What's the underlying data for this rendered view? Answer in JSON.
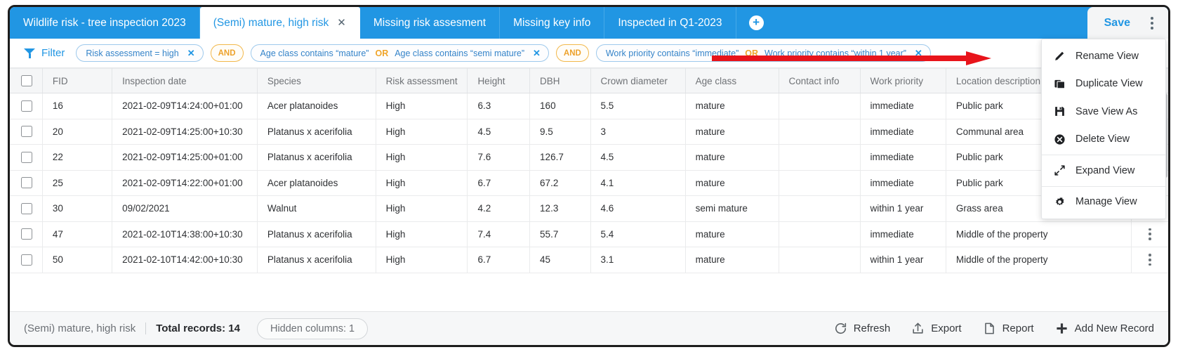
{
  "window": {
    "accent_blue": "#2196e3",
    "arrow_color": "#e8141b"
  },
  "tabs": [
    {
      "label": "Wildlife risk - tree inspection 2023",
      "active": false,
      "closable": false
    },
    {
      "label": "(Semi) mature, high risk",
      "active": true,
      "closable": true,
      "close_glyph": "✕"
    },
    {
      "label": "Missing risk assesment",
      "active": false,
      "closable": false
    },
    {
      "label": "Missing key info",
      "active": false,
      "closable": false
    },
    {
      "label": "Inspected in Q1-2023",
      "active": false,
      "closable": false
    }
  ],
  "tabbar": {
    "add_tab_glyph": "+",
    "add_tab_name": "add-view-tab",
    "save_label": "Save",
    "kebab_name": "view-options-kebab"
  },
  "filterbar": {
    "label": "Filter",
    "chips": [
      {
        "parts": [
          {
            "type": "text",
            "value": "Risk assessment = high"
          }
        ],
        "close_glyph": "✕"
      },
      {
        "parts": [
          {
            "type": "text",
            "value": "Age class contains “mature”"
          },
          {
            "type": "op",
            "value": "OR"
          },
          {
            "type": "text",
            "value": "Age class contains “semi mature”"
          }
        ],
        "close_glyph": "✕"
      },
      {
        "parts": [
          {
            "type": "text",
            "value": "Work priority contains “immediate”"
          },
          {
            "type": "op",
            "value": "OR"
          },
          {
            "type": "text",
            "value": "Work priority contains “within 1 year”"
          }
        ],
        "close_glyph": "✕"
      }
    ],
    "conjunctions": [
      "AND",
      "AND"
    ]
  },
  "table": {
    "columns": [
      "FID",
      "Inspection date",
      "Species",
      "Risk assessment",
      "Height",
      "DBH",
      "Crown diameter",
      "Age class",
      "Contact info",
      "Work priority",
      "Location description"
    ],
    "rows": [
      {
        "fid": "16",
        "inspection_date": "2021-02-09T14:24:00+01:00",
        "species": "Acer platanoides",
        "risk_assessment": "High",
        "height": "6.3",
        "dbh": "160",
        "crown_diameter": "5.5",
        "age_class": "mature",
        "contact_info": "",
        "work_priority": "immediate",
        "location_description": "Public park"
      },
      {
        "fid": "20",
        "inspection_date": "2021-02-09T14:25:00+10:30",
        "species": "Platanus x acerifolia",
        "risk_assessment": "High",
        "height": "4.5",
        "dbh": "9.5",
        "crown_diameter": "3",
        "age_class": "mature",
        "contact_info": "",
        "work_priority": "immediate",
        "location_description": "Communal area"
      },
      {
        "fid": "22",
        "inspection_date": "2021-02-09T14:25:00+01:00",
        "species": "Platanus x acerifolia",
        "risk_assessment": "High",
        "height": "7.6",
        "dbh": "126.7",
        "crown_diameter": "4.5",
        "age_class": "mature",
        "contact_info": "",
        "work_priority": "immediate",
        "location_description": "Public park"
      },
      {
        "fid": "25",
        "inspection_date": "2021-02-09T14:22:00+01:00",
        "species": "Acer platanoides",
        "risk_assessment": "High",
        "height": "6.7",
        "dbh": "67.2",
        "crown_diameter": "4.1",
        "age_class": "mature",
        "contact_info": "",
        "work_priority": "immediate",
        "location_description": "Public park"
      },
      {
        "fid": "30",
        "inspection_date": "09/02/2021",
        "species": "Walnut",
        "risk_assessment": "High",
        "height": "4.2",
        "dbh": "12.3",
        "crown_diameter": "4.6",
        "age_class": "semi mature",
        "contact_info": "",
        "work_priority": "within 1 year",
        "location_description": "Grass area"
      },
      {
        "fid": "47",
        "inspection_date": "2021-02-10T14:38:00+10:30",
        "species": "Platanus x acerifolia",
        "risk_assessment": "High",
        "height": "7.4",
        "dbh": "55.7",
        "crown_diameter": "5.4",
        "age_class": "mature",
        "contact_info": "",
        "work_priority": "immediate",
        "location_description": "Middle of the property"
      },
      {
        "fid": "50",
        "inspection_date": "2021-02-10T14:42:00+10:30",
        "species": "Platanus x acerifolia",
        "risk_assessment": "High",
        "height": "6.7",
        "dbh": "45",
        "crown_diameter": "3.1",
        "age_class": "mature",
        "contact_info": "",
        "work_priority": "within 1 year",
        "location_description": "Middle of the property"
      }
    ]
  },
  "view_menu": {
    "items": [
      {
        "label": "Rename View",
        "icon": "pencil-icon"
      },
      {
        "label": "Duplicate View",
        "icon": "duplicate-icon"
      },
      {
        "label": "Save View As",
        "icon": "floppy-disk-icon"
      },
      {
        "label": "Delete View",
        "icon": "delete-circle-icon"
      },
      {
        "label": "Expand View",
        "icon": "expand-arrows-icon"
      },
      {
        "label": "Manage View",
        "icon": "gear-icon"
      }
    ]
  },
  "footer": {
    "view_name": "(Semi) mature, high risk",
    "total_records": "Total records: 14",
    "hidden_columns": "Hidden columns: 1",
    "actions": [
      {
        "label": "Refresh",
        "icon": "refresh-icon"
      },
      {
        "label": "Export",
        "icon": "export-icon"
      },
      {
        "label": "Report",
        "icon": "report-icon"
      },
      {
        "label": "Add New Record",
        "icon": "plus-icon"
      }
    ]
  }
}
